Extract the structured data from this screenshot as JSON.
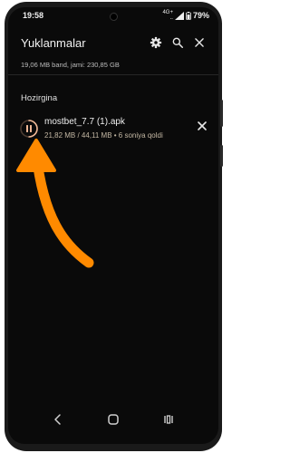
{
  "status": {
    "time": "19:58",
    "network_line1": "4G+",
    "network_line2": "..",
    "battery": "79%"
  },
  "header": {
    "title": "Yuklanmalar"
  },
  "storage": {
    "text": "19,06 MB band, jami: 230,85 GB"
  },
  "section": {
    "title": "Hozirgina"
  },
  "download": {
    "filename": "mostbet_7.7 (1).apk",
    "progress_text": "21,82 MB / 44,11 MB • 6 soniya qoldi",
    "progress": 0.495,
    "state": "paused-icon"
  },
  "icons": {
    "settings": "gear-icon",
    "search": "search-icon",
    "close": "close-icon",
    "nav_back": "back-icon",
    "nav_home": "home-icon",
    "nav_recents": "recents-icon"
  },
  "colors": {
    "accent": "#ff8a00",
    "background": "#0a0a0a",
    "ring": "#f0b896"
  }
}
